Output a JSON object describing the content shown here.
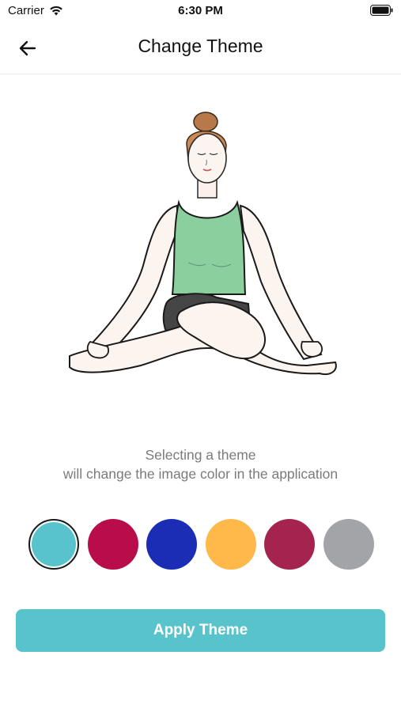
{
  "status_bar": {
    "carrier": "Carrier",
    "time": "6:30 PM",
    "icons": [
      "wifi-icon",
      "battery-icon"
    ]
  },
  "nav": {
    "back_icon": "arrow-left-icon",
    "title": "Change Theme"
  },
  "illustration": {
    "subject": "meditating-person",
    "top_color": "#8ccf9e"
  },
  "description": {
    "line1": "Selecting a theme",
    "line2": "will change the image color in the application"
  },
  "themes": {
    "selected_index": 0,
    "colors": [
      "#58c3cb",
      "#b80d4a",
      "#1b2db5",
      "#ffb84a",
      "#a4234f",
      "#a3a4a8"
    ]
  },
  "apply_button": {
    "label": "Apply Theme",
    "color": "#58c3cb"
  }
}
